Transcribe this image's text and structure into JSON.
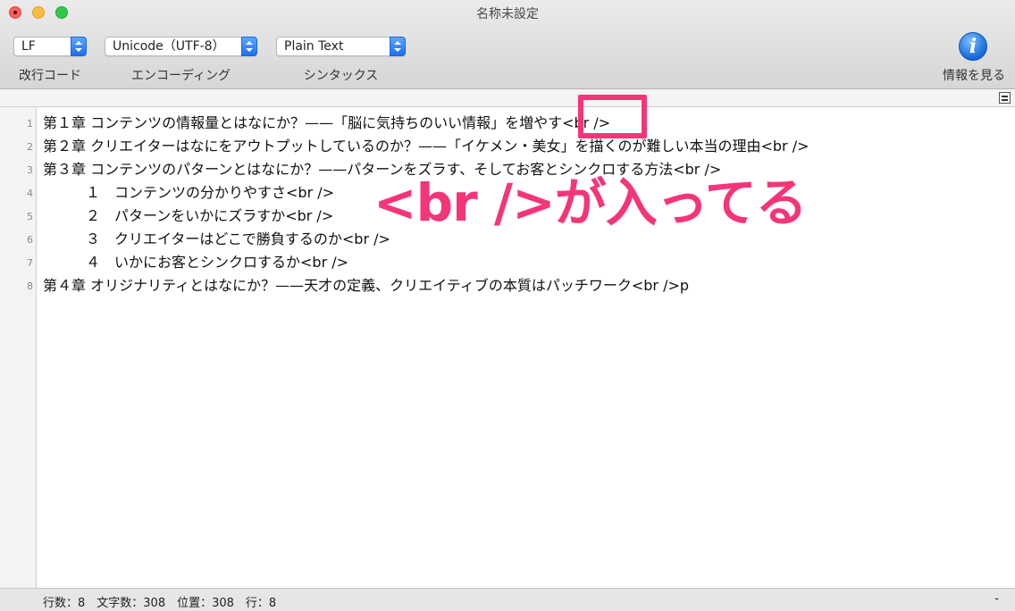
{
  "window": {
    "title": "名称未設定"
  },
  "toolbar": {
    "line_ending": {
      "value": "LF",
      "label": "改行コード"
    },
    "encoding": {
      "value": "Unicode（UTF-8）",
      "label": "エンコーディング"
    },
    "syntax": {
      "value": "Plain Text",
      "label": "シンタックス"
    },
    "info": {
      "glyph": "i",
      "label": "情報を見る"
    }
  },
  "editor": {
    "line_numbers": [
      "1",
      "2",
      "3",
      "4",
      "5",
      "6",
      "7",
      "8"
    ],
    "lines": [
      "第１章 コンテンツの情報量とはなにか？——「脳に気持ちのいい情報」を増やす<br />",
      "第２章 クリエイターはなにをアウトプットしているのか？——「イケメン・美女」を描くのが難しい本当の理由<br />",
      "第３章 コンテンツのパターンとはなにか？——パターンをズラす、そしてお客とシンクロする方法<br />",
      "　　　１　コンテンツの分かりやすさ<br />",
      "　　　２　パターンをいかにズラすか<br />",
      "　　　３　クリエイターはどこで勝負するのか<br />",
      "　　　４　いかにお客とシンクロするか<br />",
      "第４章 オリジナリティとはなにか？——天才の定義、クリエイティブの本質はパッチワーク<br />p"
    ]
  },
  "status": {
    "items": "行数：8　文字数：308　位置：308　行：8",
    "right": "-"
  },
  "annotation": {
    "text": "<br />が入ってる",
    "color": "#f4357a"
  }
}
